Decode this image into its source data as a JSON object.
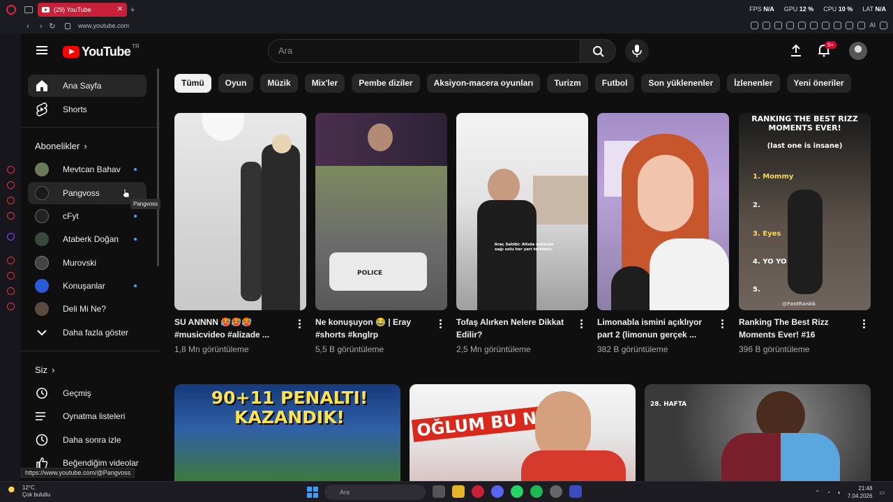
{
  "browser": {
    "tab_title": "(29) YouTube",
    "url": "www.youtube.com",
    "stats": [
      {
        "label": "FPS",
        "value": "N/A"
      },
      {
        "label": "GPU",
        "value": "12 %"
      },
      {
        "label": "CPU",
        "value": "10 %"
      },
      {
        "label": "LAT",
        "value": "N/A"
      }
    ],
    "ai_label": "AI",
    "status_url": "https://www.youtube.com/@Pangvoss"
  },
  "header": {
    "logo_text": "YouTube",
    "country": "TR",
    "search_placeholder": "Ara",
    "notification_count": "9+"
  },
  "sidebar": {
    "main": [
      {
        "label": "Ana Sayfa",
        "icon": "home-icon"
      },
      {
        "label": "Shorts",
        "icon": "shorts-icon"
      }
    ],
    "subs_title": "Abonelikler",
    "subscriptions": [
      {
        "label": "Mevtcan Bahav",
        "new": true,
        "color": "#6b7b5a"
      },
      {
        "label": "Pangvoss",
        "new": true,
        "color": "#1a1a1a"
      },
      {
        "label": "cFyt",
        "new": true,
        "color": "#222222"
      },
      {
        "label": "Ataberk Doğan",
        "new": true,
        "color": "#3a4a3a"
      },
      {
        "label": "Murovski",
        "new": false,
        "color": "#444444"
      },
      {
        "label": "Konuşanlar",
        "new": true,
        "color": "#2a5bd7"
      },
      {
        "label": "Deli Mi Ne?",
        "new": false,
        "color": "#5a4a40"
      }
    ],
    "show_more": "Daha fazla göster",
    "you_title": "Siz",
    "you_items": [
      {
        "label": "Geçmiş",
        "icon": "history-icon"
      },
      {
        "label": "Oynatma listeleri",
        "icon": "playlist-icon"
      },
      {
        "label": "Daha sonra izle",
        "icon": "clock-icon"
      },
      {
        "label": "Beğendiğim videolar",
        "icon": "like-icon"
      }
    ],
    "tooltip": "Pangvoss"
  },
  "chips": [
    "Tümü",
    "Oyun",
    "Müzik",
    "Mix'ler",
    "Pembe diziler",
    "Aksiyon-macera oyunları",
    "Turizm",
    "Futbol",
    "Son yüklenenler",
    "İzlenenler",
    "Yeni öneriler"
  ],
  "shorts": [
    {
      "title": "SU ANNNN 🥵🥵🥵 #musicvideo #alizade ...",
      "views": "1,8 Mn görüntüleme"
    },
    {
      "title": "Ne konuşuyon 😂 | Eray #shorts #knglrp",
      "views": "5,5 B görüntüleme"
    },
    {
      "title": "Tofaş Alırken Nelere Dikkat Edilir?",
      "views": "2,5 Mn görüntüleme",
      "caption": "Araç Sahibi: Altıda üstünde sağı solu her yeri tertemiz."
    },
    {
      "title": "Limonabla ismini açıklıyor part 2 (limonun gerçek ...",
      "views": "382 B görüntüleme"
    },
    {
      "title": "Ranking The Best Rizz Moments Ever! #16",
      "views": "396 B görüntüleme",
      "overlay_title": "RANKING THE BEST RIZZ MOMENTS EVER!",
      "overlay_sub": "(last one is insane)",
      "ranks": [
        "1. Mommy",
        "2.",
        "3. Eyes",
        "4. YO YO",
        "5."
      ],
      "watermark": "@FastRankk"
    }
  ],
  "videos": [
    {
      "overlay": "90+11 PENALTI! KAZANDIK!"
    },
    {
      "overlay": "OĞLUM BU NE?"
    },
    {
      "overlay": "28. HAFTA"
    }
  ],
  "taskbar": {
    "temp": "12°C",
    "weather": "Çok bulutlu",
    "search": "Ara",
    "time": "21:48",
    "date": "7.04.2026"
  }
}
